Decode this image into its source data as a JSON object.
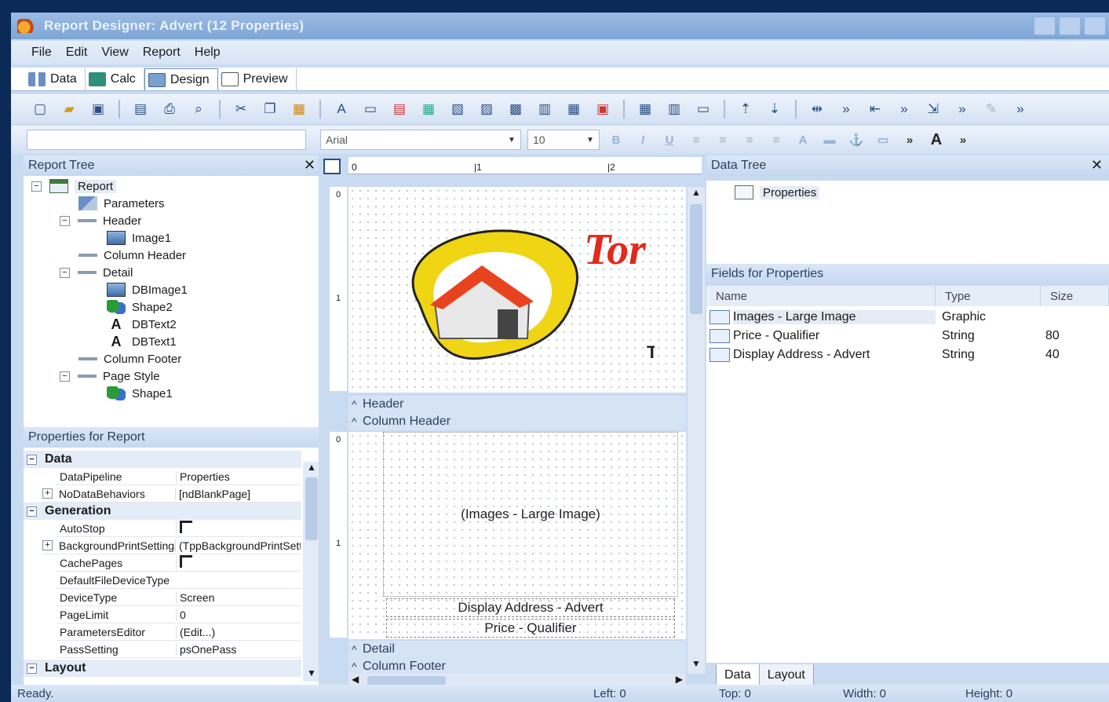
{
  "window": {
    "title": "Report Designer: Advert (12 Properties)"
  },
  "menu": [
    "File",
    "Edit",
    "View",
    "Report",
    "Help"
  ],
  "tabs": [
    {
      "label": "Data",
      "icon": "data-icon"
    },
    {
      "label": "Calc",
      "icon": "calc-icon"
    },
    {
      "label": "Design",
      "icon": "design-icon",
      "active": true
    },
    {
      "label": "Preview",
      "icon": "preview-icon"
    }
  ],
  "format_toolbar": {
    "font": "Arial",
    "size": "10"
  },
  "report_tree": {
    "title": "Report Tree",
    "nodes": [
      {
        "label": "Report",
        "icon": "report-icon"
      },
      {
        "label": "Parameters",
        "icon": "parameters-icon"
      },
      {
        "label": "Header",
        "icon": "band-icon"
      },
      {
        "label": "Image1",
        "icon": "image-icon"
      },
      {
        "label": "Column Header",
        "icon": "band-icon"
      },
      {
        "label": "Detail",
        "icon": "band-icon"
      },
      {
        "label": "DBImage1",
        "icon": "dbimage-icon"
      },
      {
        "label": "Shape2",
        "icon": "shape-icon"
      },
      {
        "label": "DBText2",
        "icon": "dbtext-icon"
      },
      {
        "label": "DBText1",
        "icon": "dbtext-icon"
      },
      {
        "label": "Column Footer",
        "icon": "band-icon"
      },
      {
        "label": "Page Style",
        "icon": "band-icon"
      },
      {
        "label": "Shape1",
        "icon": "shape-icon"
      }
    ]
  },
  "properties": {
    "title": "Properties for Report",
    "categories": [
      "Data",
      "Generation",
      "Layout"
    ],
    "data_rows": [
      {
        "key": "DataPipeline",
        "value": "Properties"
      },
      {
        "key": "NoDataBehaviors",
        "value": "[ndBlankPage]"
      }
    ],
    "generation_rows": [
      {
        "key": "AutoStop",
        "value": ""
      },
      {
        "key": "BackgroundPrintSettings",
        "value": "(TppBackgroundPrintSettings)"
      },
      {
        "key": "CachePages",
        "value": ""
      },
      {
        "key": "DefaultFileDeviceType",
        "value": ""
      },
      {
        "key": "DeviceType",
        "value": "Screen"
      },
      {
        "key": "PageLimit",
        "value": "0"
      },
      {
        "key": "ParametersEditor",
        "value": "(Edit...)"
      },
      {
        "key": "PassSetting",
        "value": "psOnePass"
      }
    ]
  },
  "designer": {
    "bands": [
      "Header",
      "Column Header",
      "Detail",
      "Column Footer"
    ],
    "logo_text": "Tor",
    "logo_subtext": "Te",
    "image_placeholder": "(Images - Large Image)",
    "address_field": "Display Address - Advert",
    "price_field": "Price - Qualifier"
  },
  "data_tree": {
    "title": "Data Tree",
    "root": "Properties"
  },
  "fields": {
    "title": "Fields for Properties",
    "columns": [
      "Name",
      "Type",
      "Size"
    ],
    "rows": [
      {
        "name": "Images - Large Image",
        "type": "Graphic",
        "size": ""
      },
      {
        "name": "Price - Qualifier",
        "type": "String",
        "size": "80"
      },
      {
        "name": "Display Address - Advert",
        "type": "String",
        "size": "40"
      }
    ]
  },
  "bottom_tabs": [
    "Data",
    "Layout"
  ],
  "status": {
    "text": "Ready.",
    "left": "Left: 0",
    "top": "Top: 0",
    "width": "Width: 0",
    "height": "Height: 0"
  },
  "colors": {
    "background": "#0b2a55",
    "chrome": "#c9dbf1",
    "logo_red": "#e02a1a",
    "logo_yellow": "#f0d515"
  }
}
